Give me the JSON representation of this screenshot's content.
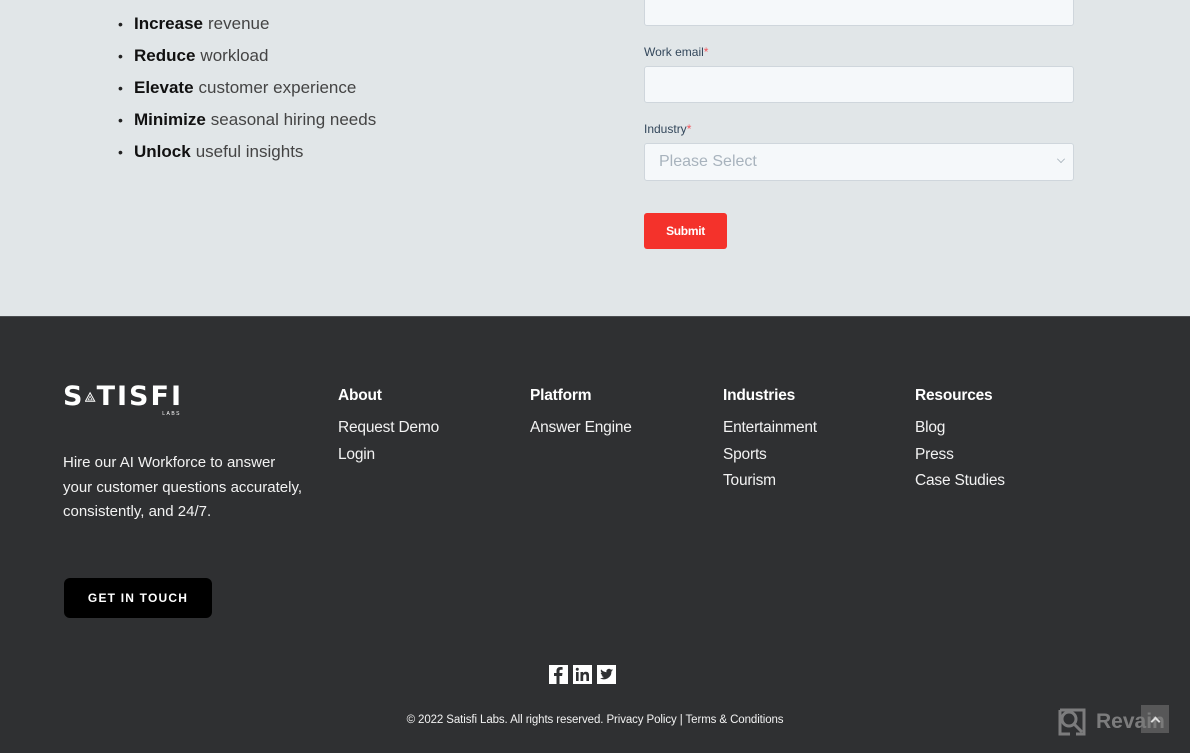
{
  "benefits": [
    {
      "bold": "Increase",
      "rest": "revenue"
    },
    {
      "bold": "Reduce",
      "rest": "workload"
    },
    {
      "bold": "Elevate",
      "rest": "customer experience"
    },
    {
      "bold": "Minimize",
      "rest": "seasonal hiring needs"
    },
    {
      "bold": "Unlock",
      "rest": "useful insights"
    }
  ],
  "form": {
    "email_label": "Work email",
    "email_value": "",
    "industry_label": "Industry",
    "required_mark": "*",
    "industry_placeholder": "Please Select",
    "submit_label": "Submit",
    "colors": {
      "submit": "#f4322b",
      "required": "#f2545b"
    }
  },
  "footer": {
    "logo_text_left": "S",
    "logo_text_right": "TISFI",
    "logo_sub": "LABS",
    "tagline": "Hire our AI Workforce to answer your customer questions accurately, consistently, and 24/7.",
    "cta_label": "GET IN TOUCH",
    "columns": [
      {
        "heading": "About",
        "links": [
          "Request Demo",
          "Login"
        ]
      },
      {
        "heading": "Platform",
        "links": [
          "Answer Engine"
        ]
      },
      {
        "heading": "Industries",
        "links": [
          "Entertainment",
          "Sports",
          "Tourism"
        ]
      },
      {
        "heading": "Resources",
        "links": [
          "Blog",
          "Press",
          "Case Studies"
        ]
      }
    ],
    "social": [
      {
        "icon": "facebook-icon",
        "glyph": "f"
      },
      {
        "icon": "linkedin-icon",
        "glyph": "in"
      },
      {
        "icon": "twitter-icon",
        "glyph": "t"
      }
    ],
    "copyright": "© 2022 Satisfi Labs. All rights reserved.",
    "privacy_label": "Privacy Policy",
    "separator": "|",
    "terms_label": "Terms & Conditions"
  },
  "watermark": {
    "text": "Revain"
  }
}
